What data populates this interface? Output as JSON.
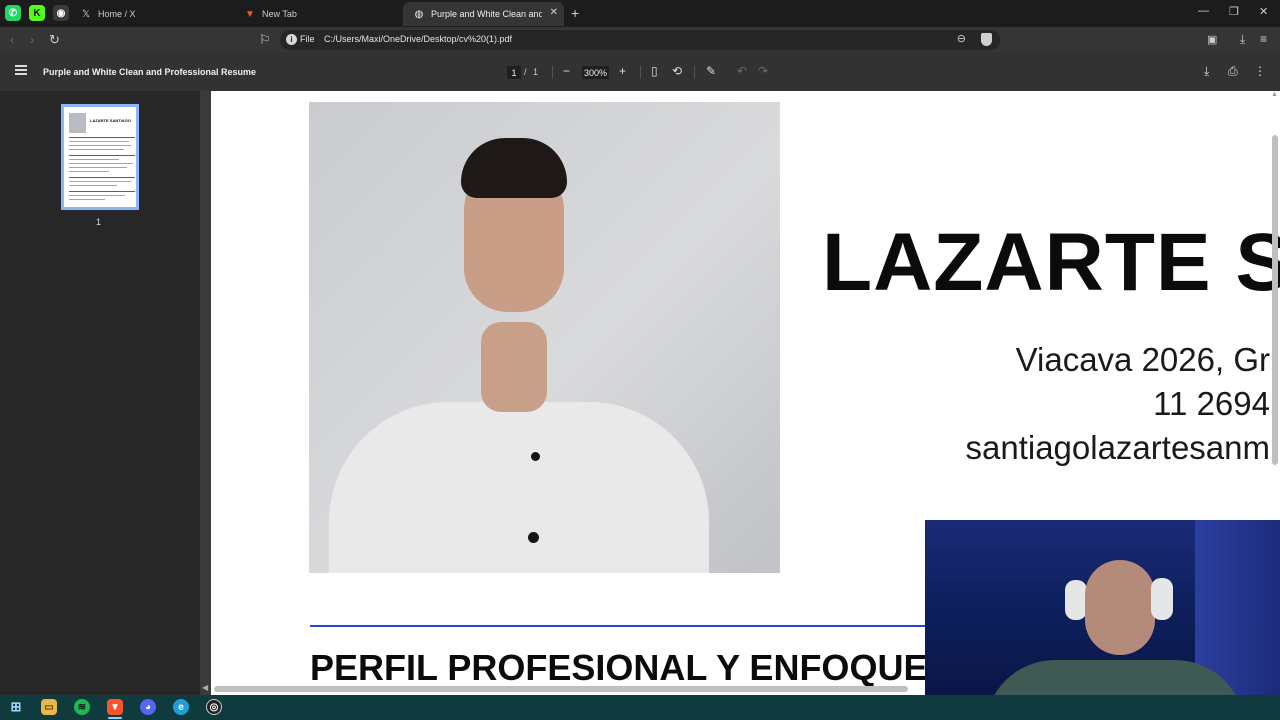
{
  "browser": {
    "pinned_tabs": [
      {
        "icon": "whatsapp-icon",
        "color": "#25d366",
        "glyph": "✆"
      },
      {
        "icon": "kick-icon",
        "color": "#53fc18",
        "glyph": "K"
      },
      {
        "icon": "messenger-icon",
        "color": "#3a3a3a",
        "glyph": "◉"
      }
    ],
    "tabs": [
      {
        "title": "Home / X",
        "icon": "x-icon",
        "active": false
      },
      {
        "title": "New Tab",
        "icon": "brave-icon",
        "active": false
      },
      {
        "title": "Purple and White Clean and Prof",
        "icon": "globe-icon",
        "active": true
      }
    ],
    "new_tab_glyph": "+",
    "window_controls": {
      "minimize": "—",
      "restore": "❐",
      "close": "✕"
    },
    "address": {
      "scheme_label": "File",
      "url": "C:/Users/Maxi/OneDrive/Desktop/cv%20(1).pdf"
    }
  },
  "pdf_viewer": {
    "title": "Purple and White Clean and Professional Resume",
    "page_current": "1",
    "page_separator": "/",
    "page_total": "1",
    "zoom": "300%",
    "thumbnail_label": "1",
    "thumbnail_name": "LAZARTE SANTIAGO"
  },
  "document": {
    "name": "LAZARTE S",
    "address_line": "Viacava 2026, Gr",
    "phone_line": "11 2694",
    "email_line": "santiagolazartesanm",
    "section_heading": "PERFIL PROFESIONAL Y ENFOQUE",
    "accent_color": "#2547c9"
  },
  "taskbar": {
    "items": [
      {
        "icon": "windows-start-icon",
        "color": "#0f3b3f",
        "glyph": "⊞"
      },
      {
        "icon": "file-explorer-icon",
        "color": "#e8b84a",
        "glyph": "▭"
      },
      {
        "icon": "spotify-icon",
        "color": "#1db954",
        "glyph": "≋"
      },
      {
        "icon": "brave-icon",
        "color": "#fb542b",
        "glyph": "▼"
      },
      {
        "icon": "discord-icon",
        "color": "#5865f2",
        "glyph": "◕"
      },
      {
        "icon": "edge-icon",
        "color": "#1f9fd8",
        "glyph": "e"
      },
      {
        "icon": "obs-icon",
        "color": "#222222",
        "glyph": "◎"
      }
    ]
  }
}
